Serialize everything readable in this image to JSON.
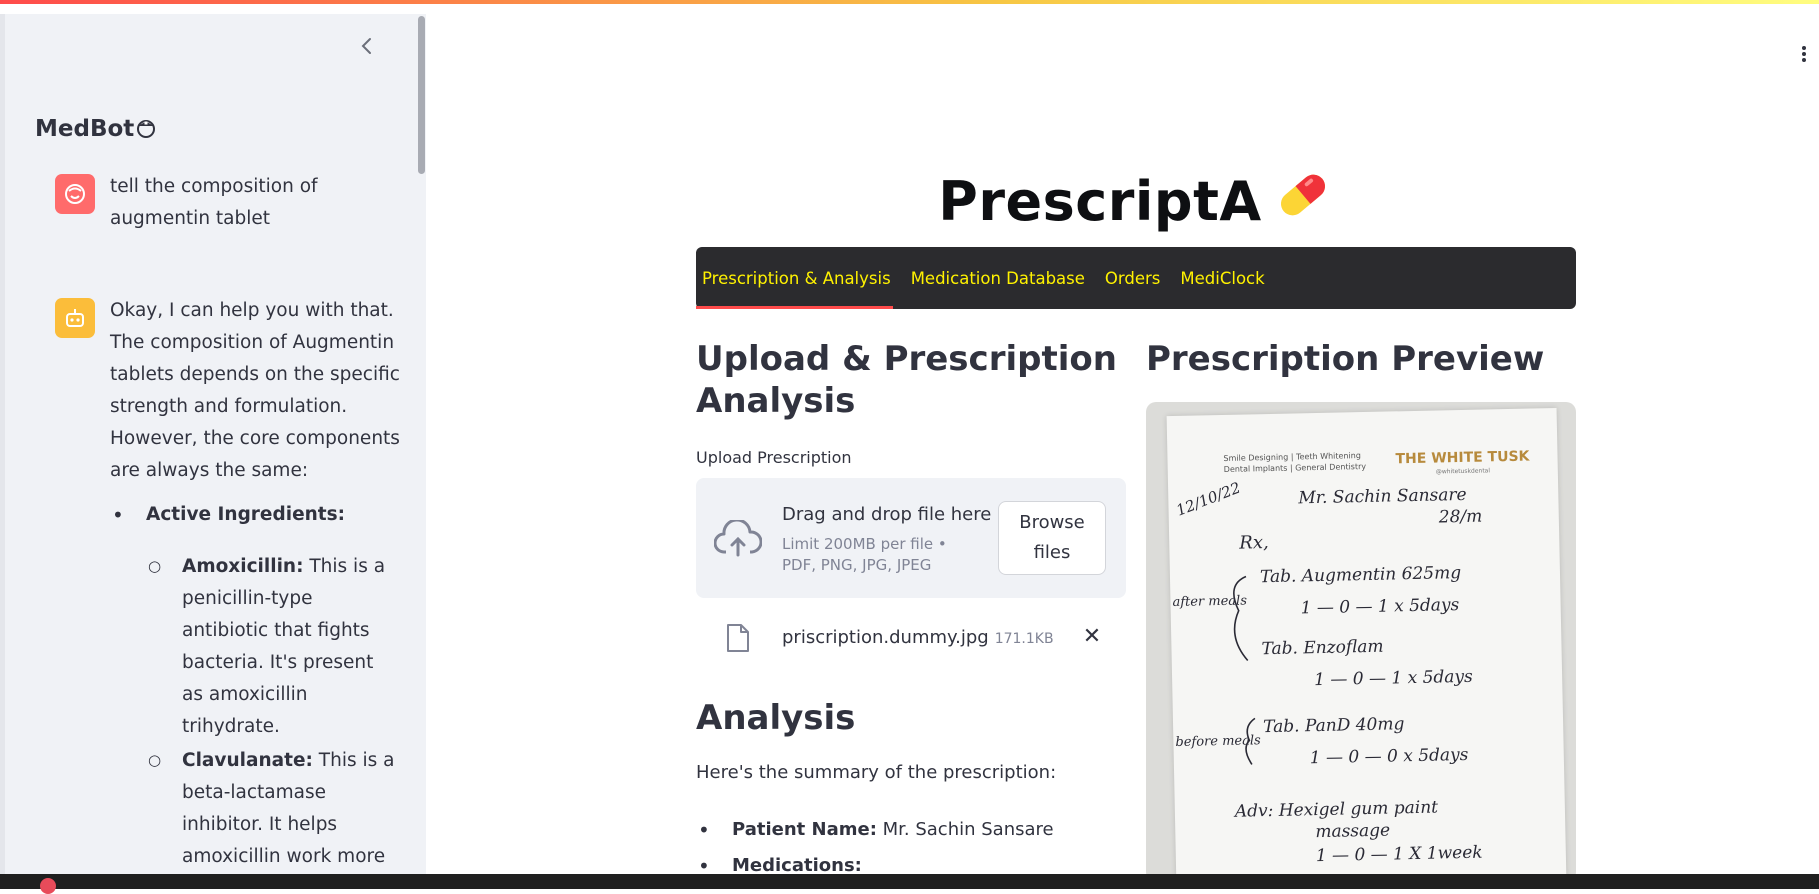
{
  "sidebar": {
    "title": "MedBot",
    "collapse_icon": "chevron-left-icon",
    "messages": {
      "user": {
        "text": "tell the composition of augmentin tablet"
      },
      "bot": {
        "p1": "Okay, I can help you with that. The composition of Augmentin tablets depends on the specific strength and formulation. However, the core components are always the same:",
        "active_heading": "Active Ingredients:",
        "amox_label": "Amoxicillin:",
        "amox_text": " This is a penicillin-type antibiotic that fights bacteria. It's present as amoxicillin trihydrate.",
        "clav_label": "Clavulanate:",
        "clav_text": " This is a beta-lactamase inhibitor. It helps amoxicillin work more effectively by"
      }
    }
  },
  "main": {
    "title": "PrescriptA",
    "tabs": [
      "Prescription & Analysis",
      "Medication Database",
      "Orders",
      "MediClock"
    ],
    "active_tab": 0,
    "upload_heading": "Upload & Prescription Analysis",
    "upload_label": "Upload Prescription",
    "dropzone": {
      "main": "Drag and drop file here",
      "sub": "Limit 200MB per file • PDF, PNG, JPG, JPEG",
      "browse": "Browse files"
    },
    "file": {
      "name": "priscription.dummy.jpg",
      "size": "171.1KB"
    },
    "analysis_heading": "Analysis",
    "summary_intro": "Here's the summary of the prescription:",
    "patient_label": "Patient Name:",
    "patient_name": " Mr. Sachin Sansare",
    "medications_label": "Medications:",
    "preview_heading": "Prescription Preview",
    "prescription": {
      "clinic_services": "Smile Designing | Teeth Whitening",
      "clinic_services2": "Dental Implants | General Dentistry",
      "clinic_name": "THE WHITE TUSK",
      "clinic_handle": "@whitetuskdental",
      "date": "12/10/22",
      "patient": "Mr. Sachin Sansare",
      "age": "28/m",
      "rx": "Rx,",
      "after_meals": "after meals",
      "line1": "Tab. Augmentin 625mg",
      "line1_dose": "1 — 0 — 1  x 5days",
      "line2": "Tab. Enzoflam",
      "line2_dose": "1 — 0 — 1  x 5days",
      "before_meals": "before meals",
      "line3": "Tab. PanD 40mg",
      "line3_dose": "1 — 0 — 0  x 5days",
      "adv": "Adv: Hexigel gum paint",
      "adv2": "massage",
      "adv_dose": "1 — 0 — 1  X 1week"
    }
  },
  "colors": {
    "accent": "#ff4b4b",
    "tab_text": "#fff200",
    "tabbar": "#2b2b2e",
    "sidebar_bg": "#f0f2f6"
  }
}
